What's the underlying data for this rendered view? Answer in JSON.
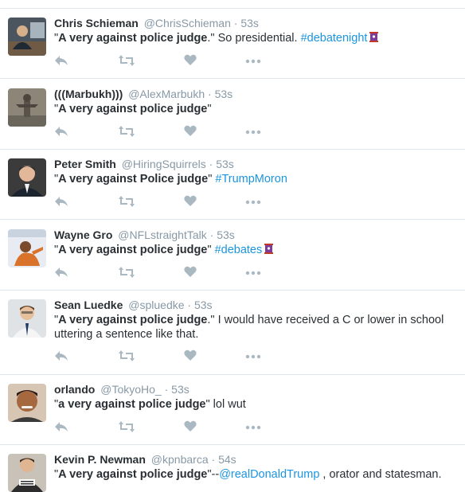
{
  "colors": {
    "text": "#292f33",
    "muted": "#8899a6",
    "link": "#1b95e0",
    "icon": "#aab8c2",
    "divider": "#e1e8ed"
  },
  "tweets": [
    {
      "name": "Chris Schieman",
      "handle": "@ChrisSchieman",
      "sep": "·",
      "time": "53s",
      "q_open": "\"",
      "bold": "A very against police judge",
      "q_close": ".\"",
      "rest": " So presidential. ",
      "hashtag": "#debatenight",
      "avatar": "person-at-desk-avatar"
    },
    {
      "name": "(((Marbukh)))",
      "handle": "@AlexMarbukh",
      "sep": "·",
      "time": "53s",
      "q_open": "\"",
      "bold": "A very against police judge",
      "q_close": "\"",
      "avatar": "statue-avatar"
    },
    {
      "name": "Peter Smith",
      "handle": "@HiringSquirrels",
      "sep": "·",
      "time": "53s",
      "q_open": "\"",
      "bold": "A very against Police judge",
      "q_close": "\" ",
      "hashtag": "#TrumpMoron",
      "avatar": "suited-man-avatar"
    },
    {
      "name": "Wayne Gro",
      "handle": "@NFLstraightTalk",
      "sep": "·",
      "time": "53s",
      "q_open": "\"",
      "bold": "A very against police judge",
      "q_close": "\" ",
      "hashtag": "#debates",
      "avatar": "orange-figure-avatar"
    },
    {
      "name": "Sean Luedke",
      "handle": "@spluedke",
      "sep": "·",
      "time": "53s",
      "q_open": "\"",
      "bold": "A very against police judge",
      "q_close": ".\"",
      "rest": " I would have received a C or lower in school uttering a sentence like that.",
      "avatar": "man-with-tie-avatar"
    },
    {
      "name": "orlando",
      "handle": "@TokyoHo_",
      "sep": "·",
      "time": "53s",
      "q_open": "\"",
      "bold": "a very against police judge",
      "q_close": "\"",
      "rest": " lol wut",
      "avatar": "selfie-avatar"
    },
    {
      "name": "Kevin P. Newman",
      "handle": "@kpnbarca",
      "sep": "·",
      "time": "54s",
      "q_open": "\"",
      "bold": "A very against police judge",
      "q_close": "\"--",
      "mention": "@realDonaldTrump",
      "rest": " , orator and statesman.",
      "avatar": "real-men-shirt-avatar"
    }
  ]
}
